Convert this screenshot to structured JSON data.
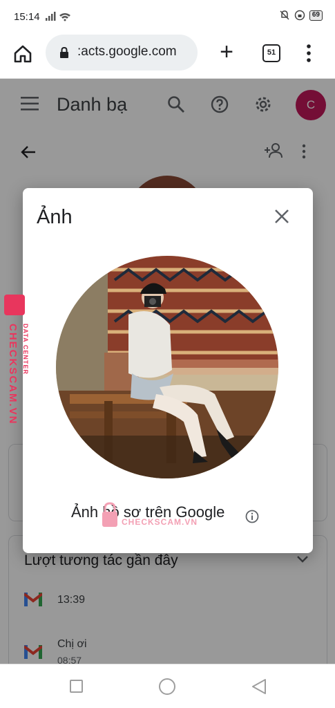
{
  "status_bar": {
    "time": "15:14",
    "battery": "69"
  },
  "browser": {
    "url": ":acts.google.com",
    "tab_count": "51"
  },
  "app": {
    "title": "Danh bạ",
    "avatar_letter": "C"
  },
  "dialog": {
    "title": "Ảnh",
    "caption": "Ảnh hồ sơ trên Google"
  },
  "recent": {
    "title": "Lượt tương tác gần đây",
    "items": [
      {
        "text": "13:39",
        "sub": ""
      },
      {
        "text": "Chị ơi",
        "sub": "08:57"
      }
    ]
  },
  "watermark": {
    "side_main": "CHECKSCAM.VN",
    "side_small": "DATA CENTER",
    "center": "CHECKSCAM.VN"
  },
  "colors": {
    "avatar": "#c2185b",
    "watermark": "#e8365d"
  }
}
